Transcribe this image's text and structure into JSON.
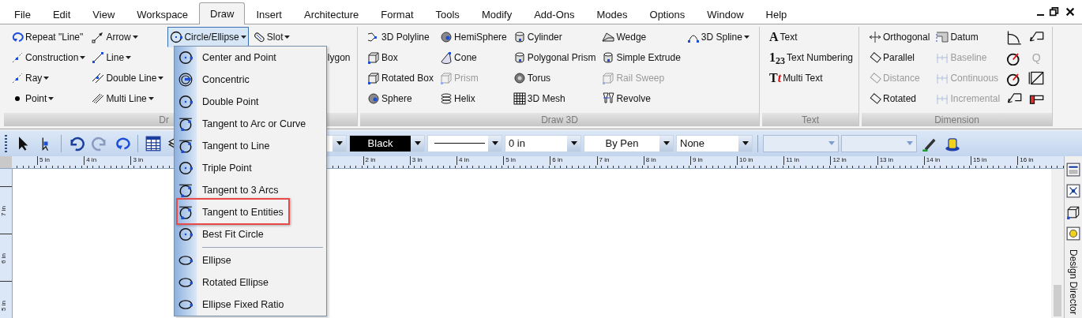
{
  "menubar": {
    "items": [
      {
        "label": "File",
        "selected": false
      },
      {
        "label": "Edit",
        "selected": false
      },
      {
        "label": "View",
        "selected": false
      },
      {
        "label": "Workspace",
        "selected": false
      },
      {
        "label": "Draw",
        "selected": true
      },
      {
        "label": "Insert",
        "selected": false
      },
      {
        "label": "Architecture",
        "selected": false
      },
      {
        "label": "Format",
        "selected": false
      },
      {
        "label": "Tools",
        "selected": false
      },
      {
        "label": "Modify",
        "selected": false
      },
      {
        "label": "Add-Ons",
        "selected": false
      },
      {
        "label": "Modes",
        "selected": false
      },
      {
        "label": "Options",
        "selected": false
      },
      {
        "label": "Window",
        "selected": false
      },
      {
        "label": "Help",
        "selected": false
      }
    ]
  },
  "ribbon": {
    "groups": [
      {
        "label": "Dr",
        "label_cut": true,
        "columns": [
          [
            {
              "kind": "button",
              "label": "Repeat \"Line\"",
              "disabled": false,
              "open": false
            },
            {
              "kind": "dropdown",
              "label": "Construction",
              "disabled": false,
              "open": false
            },
            {
              "kind": "dropdown",
              "label": "Ray",
              "disabled": false,
              "open": false
            },
            {
              "kind": "dropdown",
              "label": "Point",
              "disabled": false,
              "open": false
            }
          ],
          [
            {
              "kind": "dropdown",
              "label": "Arrow",
              "disabled": false,
              "open": false
            },
            {
              "kind": "dropdown",
              "label": "Line",
              "disabled": false,
              "open": false
            },
            {
              "kind": "dropdown",
              "label": "Double Line",
              "disabled": false,
              "open": false
            },
            {
              "kind": "dropdown",
              "label": "Multi Line",
              "disabled": false,
              "open": false
            }
          ],
          [
            {
              "kind": "dropdown",
              "label": "Circle/Ellipse",
              "disabled": false,
              "open": true
            }
          ],
          [
            {
              "kind": "dropdown",
              "label": "Slot",
              "disabled": false,
              "open": false
            },
            {
              "kind": "partial",
              "label": "lygon",
              "disabled": false,
              "open": false
            }
          ]
        ]
      },
      {
        "label": "Draw 3D",
        "label_cut": false,
        "columns": [
          [
            {
              "kind": "button",
              "label": "3D Polyline",
              "disabled": false,
              "open": false
            },
            {
              "kind": "button",
              "label": "Box",
              "disabled": false,
              "open": false
            },
            {
              "kind": "button",
              "label": "Rotated Box",
              "disabled": false,
              "open": false
            },
            {
              "kind": "button",
              "label": "Sphere",
              "disabled": false,
              "open": false
            }
          ],
          [
            {
              "kind": "button",
              "label": "HemiSphere",
              "disabled": false,
              "open": false
            },
            {
              "kind": "button",
              "label": "Cone",
              "disabled": false,
              "open": false
            },
            {
              "kind": "button",
              "label": "Prism",
              "disabled": true,
              "open": false
            },
            {
              "kind": "button",
              "label": "Helix",
              "disabled": false,
              "open": false
            }
          ],
          [
            {
              "kind": "button",
              "label": "Cylinder",
              "disabled": false,
              "open": false
            },
            {
              "kind": "button",
              "label": "Polygonal Prism",
              "disabled": false,
              "open": false
            },
            {
              "kind": "button",
              "label": "Torus",
              "disabled": false,
              "open": false
            },
            {
              "kind": "button",
              "label": "3D Mesh",
              "disabled": false,
              "open": false
            }
          ],
          [
            {
              "kind": "button",
              "label": "Wedge",
              "disabled": false,
              "open": false
            },
            {
              "kind": "button",
              "label": "Simple Extrude",
              "disabled": false,
              "open": false
            },
            {
              "kind": "button",
              "label": "Rail Sweep",
              "disabled": true,
              "open": false
            },
            {
              "kind": "button",
              "label": "Revolve",
              "disabled": false,
              "open": false
            }
          ],
          [
            {
              "kind": "dropdown",
              "label": "3D Spline",
              "disabled": false,
              "open": false
            }
          ]
        ]
      },
      {
        "label": "Text",
        "label_cut": false,
        "columns": [
          [
            {
              "kind": "glyph",
              "glyph": "A",
              "label": "Text",
              "disabled": false,
              "open": false
            },
            {
              "kind": "glyph",
              "glyph": "1$_{2}$$_{3}$",
              "label": "Text Numbering",
              "disabled": false,
              "open": false
            },
            {
              "kind": "glyph",
              "glyph": "T",
              "glyph_accent": "t",
              "label": "Multi Text",
              "disabled": false,
              "open": false
            }
          ]
        ]
      },
      {
        "label": "Dimension",
        "label_cut": false,
        "columns": [
          [
            {
              "kind": "button",
              "label": "Orthogonal",
              "disabled": false,
              "open": false
            },
            {
              "kind": "button",
              "label": "Parallel",
              "disabled": false,
              "open": false
            },
            {
              "kind": "button",
              "label": "Distance",
              "disabled": true,
              "open": false
            },
            {
              "kind": "button",
              "label": "Rotated",
              "disabled": false,
              "open": false
            }
          ],
          [
            {
              "kind": "button",
              "label": "Datum",
              "disabled": false,
              "open": false
            },
            {
              "kind": "button",
              "label": "Baseline",
              "disabled": true,
              "open": false
            },
            {
              "kind": "button",
              "label": "Continuous",
              "disabled": true,
              "open": false
            },
            {
              "kind": "button",
              "label": "Incremental",
              "disabled": true,
              "open": false
            }
          ],
          [
            {
              "kind": "icon",
              "disabled": false
            },
            {
              "kind": "icon",
              "disabled": false
            },
            {
              "kind": "icon",
              "disabled": false
            },
            {
              "kind": "icon",
              "disabled": false
            }
          ],
          [
            {
              "kind": "icon",
              "disabled": false
            },
            {
              "kind": "glyph-icon",
              "glyph": "Q",
              "disabled": true
            },
            {
              "kind": "icon",
              "disabled": false
            },
            {
              "kind": "icon",
              "disabled": false
            }
          ]
        ]
      }
    ]
  },
  "circle_menu": {
    "items": [
      {
        "kind": "item",
        "label": "Center and Point",
        "highlighted": false
      },
      {
        "kind": "item",
        "label": "Concentric",
        "highlighted": false
      },
      {
        "kind": "item",
        "label": "Double Point",
        "highlighted": false
      },
      {
        "kind": "item",
        "label": "Tangent to Arc or Curve",
        "highlighted": false
      },
      {
        "kind": "item",
        "label": "Tangent to Line",
        "highlighted": false
      },
      {
        "kind": "item",
        "label": "Triple Point",
        "highlighted": false
      },
      {
        "kind": "item",
        "label": "Tangent to 3 Arcs",
        "highlighted": false
      },
      {
        "kind": "item",
        "label": "Tangent to Entities",
        "highlighted": true
      },
      {
        "kind": "item",
        "label": "Best Fit Circle",
        "highlighted": false
      },
      {
        "kind": "separator"
      },
      {
        "kind": "item",
        "label": "Ellipse",
        "highlighted": false
      },
      {
        "kind": "item",
        "label": "Rotated Ellipse",
        "highlighted": false
      },
      {
        "kind": "item",
        "label": "Ellipse Fixed Ratio",
        "highlighted": false
      }
    ]
  },
  "toolbar": {
    "fields": [
      {
        "kind": "combo"
      },
      {
        "kind": "color",
        "value": "Black"
      },
      {
        "kind": "linestyle"
      },
      {
        "kind": "combo",
        "value": "0 in"
      },
      {
        "kind": "combo-center",
        "value": "By Pen"
      },
      {
        "kind": "combo",
        "value": "None"
      },
      {
        "kind": "flat"
      },
      {
        "kind": "flat"
      }
    ]
  },
  "ruler": {
    "left_labels": [
      "5 in",
      "4 in",
      "3 in"
    ],
    "right_labels": [
      "2 in",
      "3 in",
      "4 in",
      "5 in",
      "6 in",
      "7 in",
      "8 in",
      "9 in",
      "10 in",
      "11 in",
      "12 in",
      "13 in",
      "14 in",
      "15 in",
      "16 in"
    ],
    "vertical_labels": [
      "7 in",
      "6 in",
      "5 in"
    ]
  },
  "side_panel": {
    "title": "Design Director"
  }
}
